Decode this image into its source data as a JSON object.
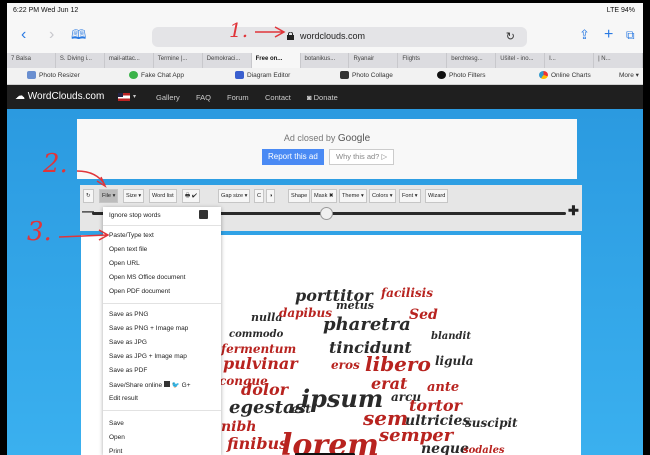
{
  "status": {
    "time_date": "6:22 PM  Wed Jun 12",
    "signal": "LTE 94%"
  },
  "browser": {
    "url": "wordclouds.com",
    "tabs": [
      "7  Balsa",
      "S. Diving i...",
      "mail-attac...",
      "Termine |...",
      "Demokraci...",
      "Free on...",
      "botanikus...",
      "Ryanair",
      "Flights",
      "berchtesg...",
      "Ušitel - ino...",
      "I...",
      "| N..."
    ],
    "active_tab_index": 5,
    "bookmarks": [
      "Photo Resizer",
      "Fake Chat App",
      "Diagram Editor",
      "Photo Collage",
      "Photo Filters",
      "Online Charts",
      "More"
    ]
  },
  "site": {
    "logo": "WordClouds.com",
    "nav": [
      "Gallery",
      "FAQ",
      "Forum",
      "Contact",
      "Donate"
    ]
  },
  "ad": {
    "closed_by": "Ad closed by",
    "google": "Google",
    "report": "Report this ad",
    "why": "Why this ad? ▷"
  },
  "toolbar": {
    "reload": "↻",
    "file": "File ▾",
    "size": "Size ▾",
    "word_list": "Word list",
    "print": "🖶 ✔",
    "gap": "Gap size ▾",
    "undo": "C",
    "contrast": "◑",
    "shape": "Shape",
    "mask": "Mask ✖",
    "theme": "Theme ▾",
    "colors": "Colors ▾",
    "font": "Font ▾",
    "wizard": "Wizard"
  },
  "file_menu": {
    "ignore": "Ignore stop words",
    "group1": [
      "Paste/Type text",
      "Open text file",
      "Open URL",
      "Open MS Office document",
      "Open PDF document"
    ],
    "group2": [
      "Save as PNG",
      "Save as PNG + Image map",
      "Save as JPG",
      "Save as JPG + Image map",
      "Save as PDF",
      "Save/Share online",
      "Edit result"
    ],
    "group3": [
      "Save",
      "Open",
      "Print"
    ]
  },
  "annotations": {
    "one": "1.",
    "two": "2.",
    "three": "3."
  },
  "colors": {
    "annotation": "#e0353a",
    "accent": "#2b9ae0",
    "word_dark": "#2a2a2a",
    "word_red": "#b8231f"
  }
}
